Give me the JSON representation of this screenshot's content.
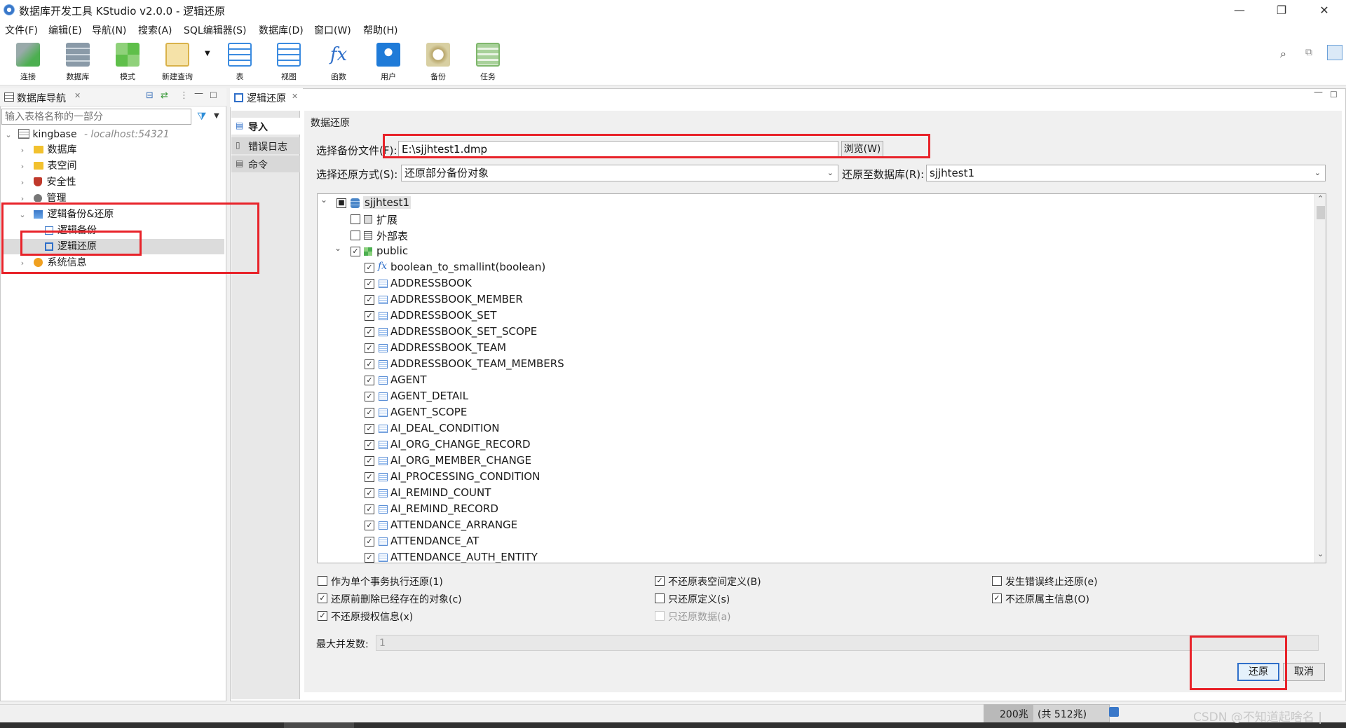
{
  "window": {
    "title": "数据库开发工具 KStudio v2.0.0 - 逻辑还原",
    "minimize_glyph": "—",
    "restore_glyph": "❐",
    "close_glyph": "✕"
  },
  "menu": [
    "文件(F)",
    "编辑(E)",
    "导航(N)",
    "搜索(A)",
    "SQL编辑器(S)",
    "数据库(D)",
    "窗口(W)",
    "帮助(H)"
  ],
  "toolbar": {
    "buttons": [
      {
        "label": "连接",
        "icon": "connect-icon"
      },
      {
        "label": "数据库",
        "icon": "database-icon"
      },
      {
        "label": "模式",
        "icon": "schema-icon"
      },
      {
        "label": "新建查询",
        "icon": "new-query-icon"
      },
      {
        "label": "表",
        "icon": "table-icon"
      },
      {
        "label": "视图",
        "icon": "view-icon"
      },
      {
        "label": "函数",
        "icon": "function-icon"
      },
      {
        "label": "用户",
        "icon": "user-icon"
      },
      {
        "label": "备份",
        "icon": "backup-icon"
      },
      {
        "label": "任务",
        "icon": "task-icon"
      }
    ],
    "function_glyph": "fx"
  },
  "navigator": {
    "tab_label": "数据库导航",
    "filter_placeholder": "输入表格名称的一部分",
    "connection": {
      "name": "kingbase",
      "host": "- localhost:54321"
    },
    "items": [
      {
        "label": "数据库"
      },
      {
        "label": "表空间"
      },
      {
        "label": "安全性"
      },
      {
        "label": "管理"
      },
      {
        "label": "逻辑备份&还原"
      },
      {
        "label": "逻辑备份"
      },
      {
        "label": "逻辑还原"
      },
      {
        "label": "系统信息"
      }
    ]
  },
  "editor": {
    "tab_label": "逻辑还原",
    "side_tabs": [
      "导入",
      "错误日志",
      "命令"
    ],
    "section_title": "数据还原",
    "backup_file_label": "选择备份文件(F):",
    "backup_file_value": "E:\\sjjhtest1.dmp",
    "browse_label": "浏览(W)",
    "restore_mode_label": "选择还原方式(S):",
    "restore_mode_value": "还原部分备份对象",
    "target_db_label": "还原至数据库(R):",
    "target_db_value": "sjjhtest1",
    "tree": {
      "root": "sjjhtest1",
      "nodes": [
        {
          "label": "扩展",
          "checked": false
        },
        {
          "label": "外部表",
          "checked": false
        },
        {
          "label": "public",
          "checked": true
        }
      ],
      "objects": [
        {
          "label": "boolean_to_smallint(boolean)",
          "type": "function"
        },
        {
          "label": "ADDRESSBOOK",
          "type": "table"
        },
        {
          "label": "ADDRESSBOOK_MEMBER",
          "type": "table"
        },
        {
          "label": "ADDRESSBOOK_SET",
          "type": "table"
        },
        {
          "label": "ADDRESSBOOK_SET_SCOPE",
          "type": "table"
        },
        {
          "label": "ADDRESSBOOK_TEAM",
          "type": "table"
        },
        {
          "label": "ADDRESSBOOK_TEAM_MEMBERS",
          "type": "table"
        },
        {
          "label": "AGENT",
          "type": "table"
        },
        {
          "label": "AGENT_DETAIL",
          "type": "table"
        },
        {
          "label": "AGENT_SCOPE",
          "type": "table"
        },
        {
          "label": "AI_DEAL_CONDITION",
          "type": "table"
        },
        {
          "label": "AI_ORG_CHANGE_RECORD",
          "type": "table"
        },
        {
          "label": "AI_ORG_MEMBER_CHANGE",
          "type": "table"
        },
        {
          "label": "AI_PROCESSING_CONDITION",
          "type": "table"
        },
        {
          "label": "AI_REMIND_COUNT",
          "type": "table"
        },
        {
          "label": "AI_REMIND_RECORD",
          "type": "table"
        },
        {
          "label": "ATTENDANCE_ARRANGE",
          "type": "table"
        },
        {
          "label": "ATTENDANCE_AT",
          "type": "table"
        },
        {
          "label": "ATTENDANCE_AUTH_ENTITY",
          "type": "table"
        }
      ]
    },
    "options": [
      {
        "label": "作为单个事务执行还原(1)",
        "checked": false,
        "disabled": false
      },
      {
        "label": "不还原表空间定义(B)",
        "checked": true,
        "disabled": false
      },
      {
        "label": "发生错误终止还原(e)",
        "checked": false,
        "disabled": false
      },
      {
        "label": "还原前删除已经存在的对象(c)",
        "checked": true,
        "disabled": false
      },
      {
        "label": "只还原定义(s)",
        "checked": false,
        "disabled": false
      },
      {
        "label": "不还原属主信息(O)",
        "checked": true,
        "disabled": false
      },
      {
        "label": "不还原授权信息(x)",
        "checked": true,
        "disabled": false
      },
      {
        "label": "只还原数据(a)",
        "checked": false,
        "disabled": true
      }
    ],
    "max_concurrency_label": "最大并发数:",
    "max_concurrency_value": "1",
    "restore_button": "还原",
    "cancel_button": "取消"
  },
  "statusbar": {
    "memory_used": "200兆",
    "memory_total": "(共 512兆)"
  },
  "watermark": "CSDN @不知道起啥名 |",
  "colors": {
    "highlight_red": "#e8232a",
    "selection": "#dcdcdc",
    "accent_blue": "#2f6fc9"
  }
}
